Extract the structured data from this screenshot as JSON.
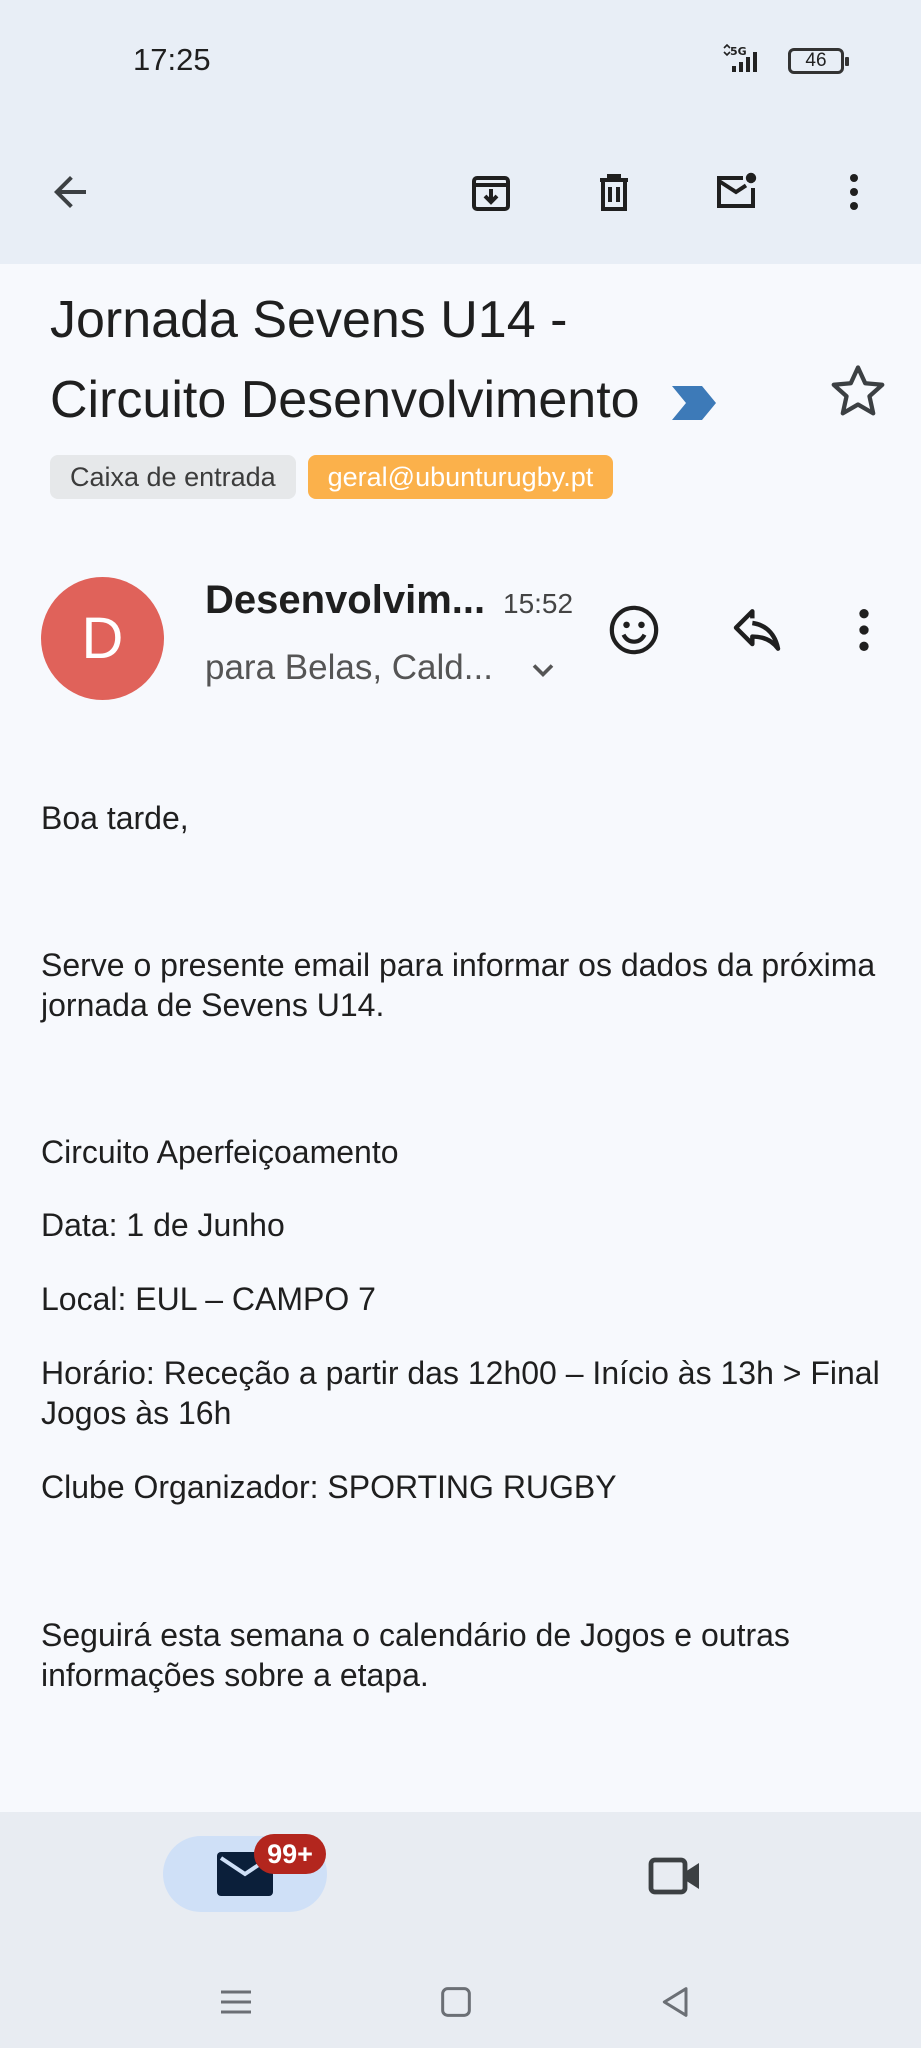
{
  "status_bar": {
    "time": "17:25",
    "network": "5G",
    "battery": "46"
  },
  "subject": {
    "line1": "Jornada Sevens U14 -",
    "line2": "Circuito Desenvolvimento"
  },
  "labels": [
    "Caixa de entrada",
    "geral@ubunturugby.pt"
  ],
  "sender": {
    "initial": "D",
    "name": "Desenvolvim...",
    "time": "15:52",
    "recipients": "para Belas, Cald..."
  },
  "body": {
    "greeting": "Boa tarde,",
    "intro": "Serve o presente email para informar os dados da próxima jornada de Sevens U14.",
    "circuit": "Circuito Aperfeiçoamento",
    "date": "Data: 1 de Junho",
    "location": "Local: EUL – CAMPO 7",
    "schedule": "Horário: Receção a partir das 12h00 – Início às 13h > Final Jogos às 16h",
    "organizer": "Clube Organizador: SPORTING RUGBY",
    "followup": "Seguirá esta semana o calendário de Jogos e outras informações sobre a etapa."
  },
  "bottom_nav": {
    "mail_badge": "99+"
  },
  "colors": {
    "avatar": "#e0625a",
    "label_geral": "#fbb14b",
    "badge": "#b3261e",
    "importance": "#3d7ab8"
  }
}
